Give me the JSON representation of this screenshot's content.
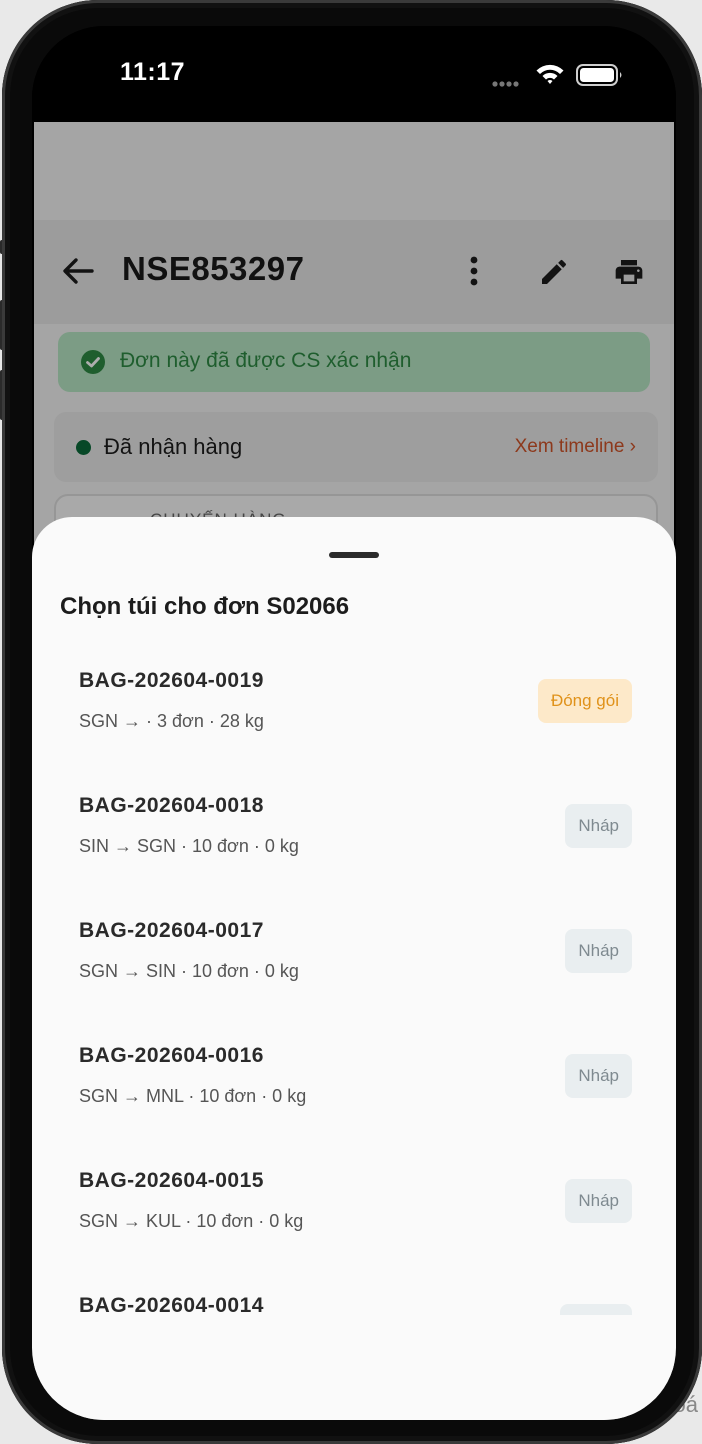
{
  "status_bar": {
    "time": "11:17"
  },
  "order": {
    "title": "NSE853297",
    "confirmed_banner": "Đơn này đã được CS xác nhận",
    "status_label": "Đã nhận hàng",
    "timeline_link": "Xem timeline ›",
    "shipping_section_title": "CHUYẾN HÀNG"
  },
  "sheet": {
    "title": "Chọn túi cho đơn S02066",
    "bags": [
      {
        "code": "BAG-202604-0019",
        "meta": "SGN →  · 3 đơn · 28 kg",
        "status": "Đóng gói",
        "status_type": "packing"
      },
      {
        "code": "BAG-202604-0018",
        "meta": "SIN → SGN · 10 đơn · 0 kg",
        "status": "Nháp",
        "status_type": "draft"
      },
      {
        "code": "BAG-202604-0017",
        "meta": "SGN → SIN · 10 đơn · 0 kg",
        "status": "Nháp",
        "status_type": "draft"
      },
      {
        "code": "BAG-202604-0016",
        "meta": "SGN → MNL · 10 đơn · 0 kg",
        "status": "Nháp",
        "status_type": "draft"
      },
      {
        "code": "BAG-202604-0015",
        "meta": "SGN → KUL · 10 đơn · 0 kg",
        "status": "Nháp",
        "status_type": "draft"
      },
      {
        "code": "BAG-202604-0014",
        "meta": "",
        "status": "",
        "status_type": "draft"
      }
    ]
  },
  "background": {
    "peek_text": "Xoá"
  },
  "colors": {
    "accent_orange": "#d0542a",
    "success_green": "#2e8b45",
    "status_dot": "#0b6b3a",
    "badge_packing_bg": "#fde9c9",
    "badge_packing_text": "#e0921a",
    "badge_draft_bg": "#e9eef0",
    "badge_draft_text": "#7f8a90"
  },
  "icons": [
    "back-arrow-icon",
    "more-vertical-icon",
    "edit-pencil-icon",
    "print-icon",
    "check-circle-icon",
    "wifi-icon",
    "battery-icon",
    "cellular-signal-icon"
  ]
}
